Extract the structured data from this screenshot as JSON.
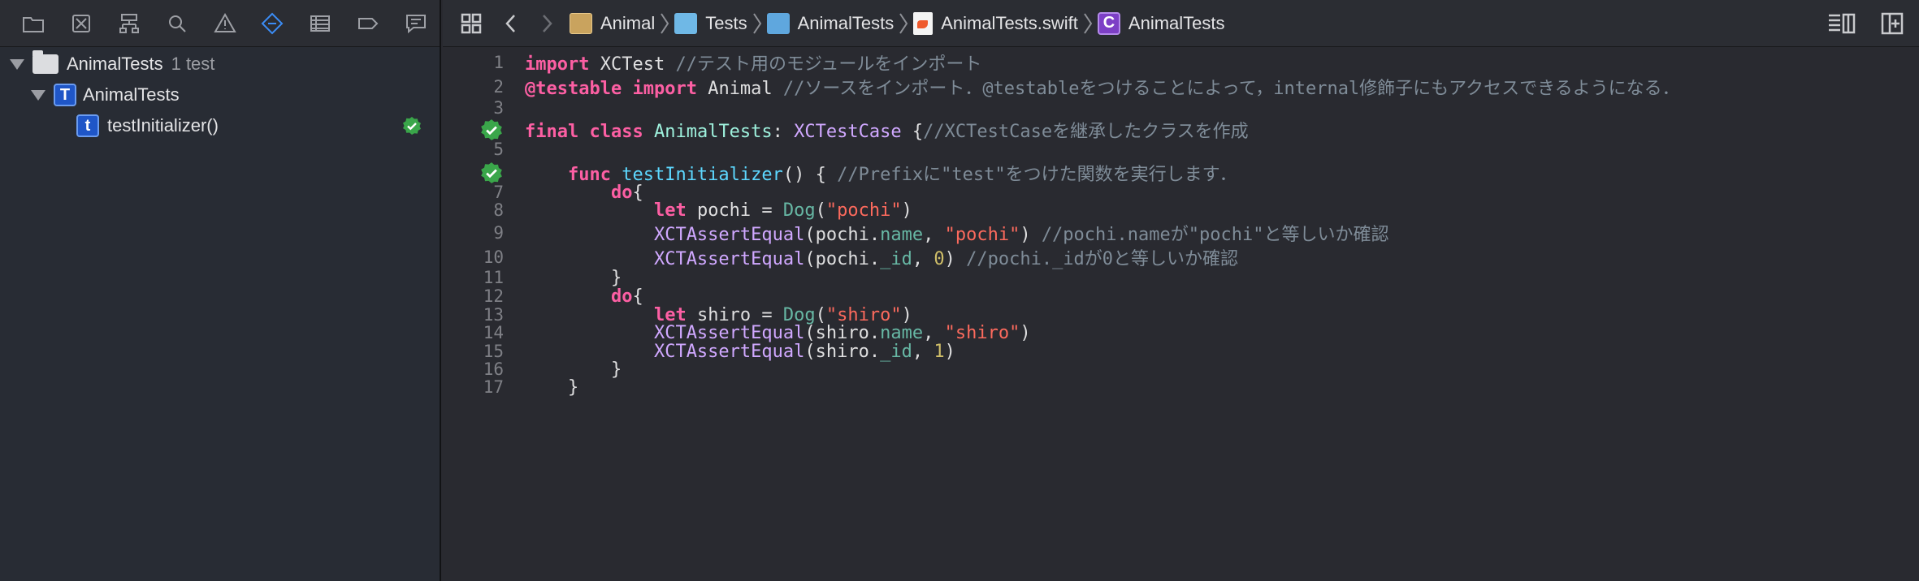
{
  "navigator": {
    "toolbar_icons": [
      "folder-icon",
      "source-control-icon",
      "hierarchy-icon",
      "search-icon",
      "warning-icon",
      "test-navigator-icon",
      "debug-icon",
      "breakpoint-icon",
      "report-icon"
    ],
    "tree": [
      {
        "label": "AnimalTests",
        "count": "1 test",
        "kind": "test-bundle"
      },
      {
        "label": "AnimalTests",
        "kind": "test-class"
      },
      {
        "label": "testInitializer()",
        "kind": "test-method",
        "status": "passed"
      }
    ],
    "badge_class": "T",
    "badge_method": "t"
  },
  "jumpbar": {
    "crumbs": [
      "Animal",
      "Tests",
      "AnimalTests",
      "AnimalTests.swift",
      "AnimalTests"
    ],
    "class_badge": "C"
  },
  "code": {
    "line_numbers": [
      "1",
      "2",
      "3",
      "",
      "5",
      "",
      "7",
      "8",
      "9",
      "10",
      "11",
      "12",
      "13",
      "14",
      "15",
      "16",
      "17"
    ],
    "lines": [
      [
        [
          "kw",
          "import"
        ],
        [
          "pl",
          " XCTest "
        ],
        [
          "cm",
          "//テスト用のモジュールをインポート"
        ]
      ],
      [
        [
          "kw",
          "@testable"
        ],
        [
          "pl",
          " "
        ],
        [
          "kw",
          "import"
        ],
        [
          "pl",
          " Animal "
        ],
        [
          "cm",
          "//ソースをインポート．@testableをつけることによって，internal修飾子にもアクセスできるようになる．"
        ]
      ],
      [],
      [
        [
          "kw",
          "final"
        ],
        [
          "pl",
          " "
        ],
        [
          "kw",
          "class"
        ],
        [
          "pl",
          " "
        ],
        [
          "cls",
          "AnimalTests"
        ],
        [
          "pl",
          ": "
        ],
        [
          "ty",
          "XCTestCase"
        ],
        [
          "pl",
          " {"
        ],
        [
          "cm",
          "//XCTestCaseを継承したクラスを作成"
        ]
      ],
      [],
      [
        [
          "pl",
          "    "
        ],
        [
          "kw",
          "func"
        ],
        [
          "pl",
          " "
        ],
        [
          "tyd",
          "testInitializer"
        ],
        [
          "pl",
          "() { "
        ],
        [
          "cm",
          "//Prefixに\"test\"をつけた関数を実行します．"
        ]
      ],
      [
        [
          "pl",
          "        "
        ],
        [
          "kw",
          "do"
        ],
        [
          "pl",
          "{"
        ]
      ],
      [
        [
          "pl",
          "            "
        ],
        [
          "kw",
          "let"
        ],
        [
          "pl",
          " pochi = "
        ],
        [
          "fn",
          "Dog"
        ],
        [
          "pl",
          "("
        ],
        [
          "str",
          "\"pochi\""
        ],
        [
          "pl",
          ")"
        ]
      ],
      [
        [
          "pl",
          "            "
        ],
        [
          "ty",
          "XCTAssertEqual"
        ],
        [
          "pl",
          "(pochi."
        ],
        [
          "prop",
          "name"
        ],
        [
          "pl",
          ", "
        ],
        [
          "str",
          "\"pochi\""
        ],
        [
          "pl",
          ") "
        ],
        [
          "cm",
          "//pochi.nameが\"pochi\"と等しいか確認"
        ]
      ],
      [
        [
          "pl",
          "            "
        ],
        [
          "ty",
          "XCTAssertEqual"
        ],
        [
          "pl",
          "(pochi."
        ],
        [
          "prop",
          "_id"
        ],
        [
          "pl",
          ", "
        ],
        [
          "num",
          "0"
        ],
        [
          "pl",
          ") "
        ],
        [
          "cm",
          "//pochi._idが0と等しいか確認"
        ]
      ],
      [
        [
          "pl",
          "        }"
        ]
      ],
      [
        [
          "pl",
          "        "
        ],
        [
          "kw",
          "do"
        ],
        [
          "pl",
          "{"
        ]
      ],
      [
        [
          "pl",
          "            "
        ],
        [
          "kw",
          "let"
        ],
        [
          "pl",
          " shiro = "
        ],
        [
          "fn",
          "Dog"
        ],
        [
          "pl",
          "("
        ],
        [
          "str",
          "\"shiro\""
        ],
        [
          "pl",
          ")"
        ]
      ],
      [
        [
          "pl",
          "            "
        ],
        [
          "ty",
          "XCTAssertEqual"
        ],
        [
          "pl",
          "(shiro."
        ],
        [
          "prop",
          "name"
        ],
        [
          "pl",
          ", "
        ],
        [
          "str",
          "\"shiro\""
        ],
        [
          "pl",
          ")"
        ]
      ],
      [
        [
          "pl",
          "            "
        ],
        [
          "ty",
          "XCTAssertEqual"
        ],
        [
          "pl",
          "(shiro."
        ],
        [
          "prop",
          "_id"
        ],
        [
          "pl",
          ", "
        ],
        [
          "num",
          "1"
        ],
        [
          "pl",
          ")"
        ]
      ],
      [
        [
          "pl",
          "        }"
        ]
      ],
      [
        [
          "pl",
          "    }"
        ]
      ]
    ]
  },
  "colors": {
    "accent": "#3b8cf5",
    "pass_green": "#3aa64a",
    "keyword": "#fc5fa3",
    "string": "#fc6a5d",
    "comment": "#7f8c98"
  }
}
